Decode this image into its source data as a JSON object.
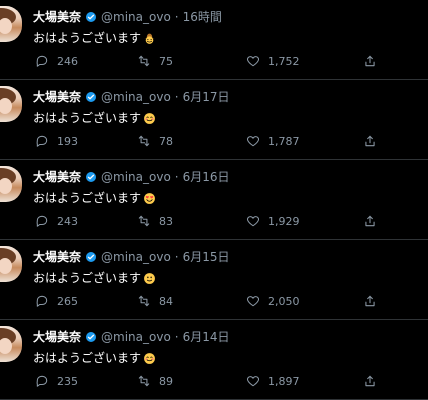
{
  "feed": {
    "tweets": [
      {
        "name": "大場美奈",
        "handle": "@mina_ovo",
        "sep": "·",
        "time": "16時間",
        "text": "おはようございます",
        "emoji": "cowboy",
        "stats": {
          "replies": "246",
          "retweets": "75",
          "likes": "1,752"
        }
      },
      {
        "name": "大場美奈",
        "handle": "@mina_ovo",
        "sep": "·",
        "time": "6月17日",
        "text": "おはようございます",
        "emoji": "smiling-face-with-hearts",
        "stats": {
          "replies": "193",
          "retweets": "78",
          "likes": "1,787"
        }
      },
      {
        "name": "大場美奈",
        "handle": "@mina_ovo",
        "sep": "·",
        "time": "6月16日",
        "text": "おはようございます",
        "emoji": "heart-eyes",
        "stats": {
          "replies": "243",
          "retweets": "83",
          "likes": "1,929"
        }
      },
      {
        "name": "大場美奈",
        "handle": "@mina_ovo",
        "sep": "·",
        "time": "6月15日",
        "text": "おはようございます",
        "emoji": "slightly-smiling",
        "stats": {
          "replies": "265",
          "retweets": "84",
          "likes": "2,050"
        }
      },
      {
        "name": "大場美奈",
        "handle": "@mina_ovo",
        "sep": "·",
        "time": "6月14日",
        "text": "おはようございます",
        "emoji": "smiling-face-with-hearts",
        "stats": {
          "replies": "235",
          "retweets": "89",
          "likes": "1,897"
        }
      }
    ]
  },
  "colors": {
    "background": "#000000",
    "text": "#ffffff",
    "muted": "#8b98a5",
    "divider": "#2f3336",
    "verified": "#1d9bf0"
  },
  "icons": {
    "reply": "reply-icon",
    "retweet": "retweet-icon",
    "like": "heart-icon",
    "share": "share-icon",
    "verified": "verified-badge-icon"
  }
}
